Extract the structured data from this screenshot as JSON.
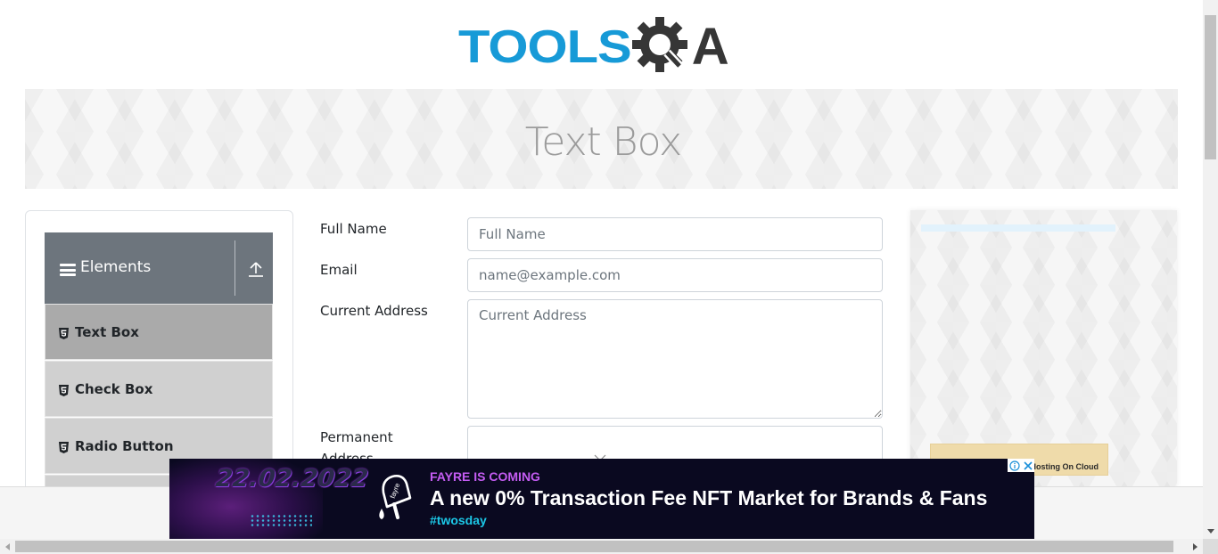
{
  "header": {
    "logo_part1": "TOOLS",
    "logo_part2": "A",
    "logo_colors": {
      "tools": "#179ad7",
      "qa": "#363636"
    }
  },
  "banner": {
    "title": "Text Box"
  },
  "sidebar": {
    "group_title": "Elements",
    "items": [
      {
        "label": "Text Box",
        "active": true
      },
      {
        "label": "Check Box",
        "active": false
      },
      {
        "label": "Radio Button",
        "active": false
      }
    ]
  },
  "form": {
    "full_name_label": "Full Name",
    "full_name_placeholder": "Full Name",
    "email_label": "Email",
    "email_placeholder": "name@example.com",
    "current_address_label": "Current Address",
    "current_address_placeholder": "Current Address",
    "permanent_address_label": "Permanent Address"
  },
  "side_ad": {
    "card_text": "Hosting On Cloud"
  },
  "bottom_ad": {
    "date_art": "22.02.2022",
    "headline_small": "FAYRE IS COMING",
    "headline_main": "A new 0% Transaction Fee NFT Market for Brands & Fans",
    "hashtag": "#twosday",
    "brand": "fayre"
  },
  "colors": {
    "sidebar_header": "#6d757d",
    "menu_item": "#d0d0d0",
    "menu_item_active": "#aaaaaa",
    "ad_background": "#0a0920"
  }
}
